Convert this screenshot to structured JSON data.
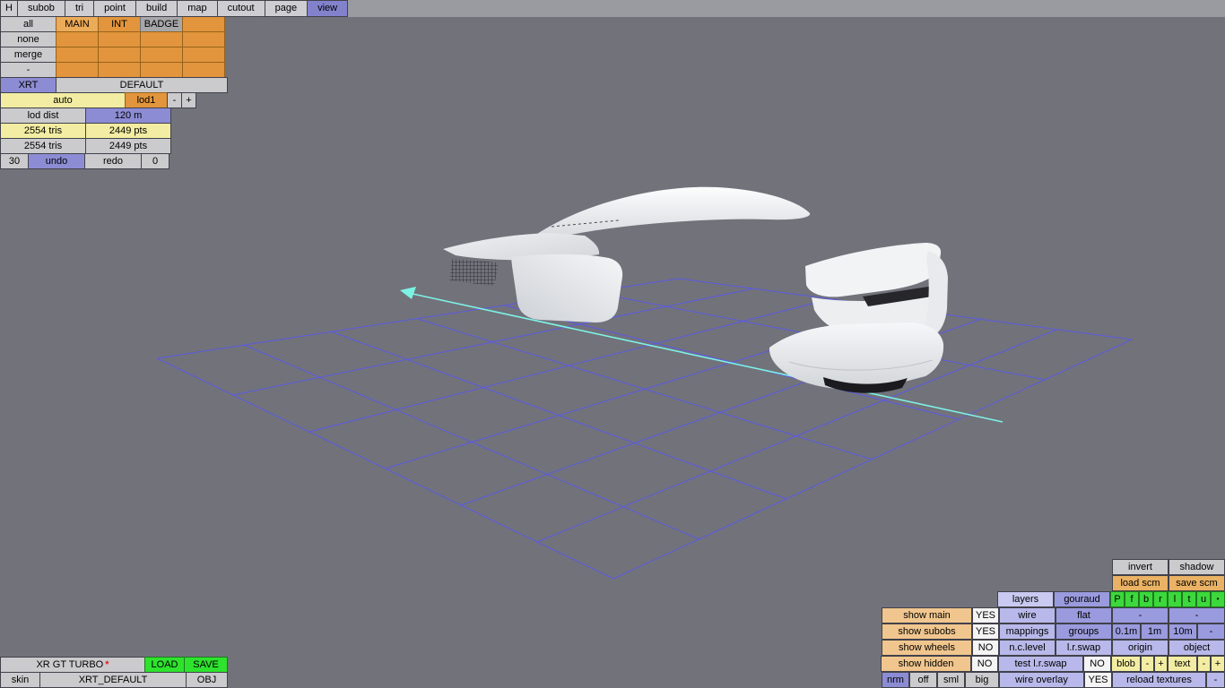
{
  "colors": {
    "viewport_bg": "#72727b",
    "grid": "#5a5ae8",
    "axis": "#7df2e4",
    "accent_blue": "#8c8cd4",
    "accent_orange": "#e2953c",
    "accent_yellow": "#f2eda2",
    "accent_tan": "#f0c68e",
    "accent_lavender": "#b8b8ea",
    "accent_purple": "#9a9ade",
    "accent_green": "#2ee22e",
    "dirty_marker_color": "#e02020"
  },
  "menubar": {
    "items": [
      "H",
      "subob",
      "tri",
      "point",
      "build",
      "map",
      "cutout",
      "page",
      "view"
    ],
    "active_item": "view"
  },
  "left_panel": {
    "select": {
      "all": "all",
      "none": "none",
      "merge": "merge",
      "dash": "-"
    },
    "materials": {
      "col1": "MAIN",
      "col2": "INT",
      "col3": "BADGE",
      "col4": ""
    },
    "bank": {
      "label": "XRT",
      "value": "DEFAULT"
    },
    "lod": {
      "auto": "auto",
      "current": "lod1",
      "minus": "-",
      "plus": "+",
      "dist_label": "lod dist",
      "dist_value": "120 m"
    },
    "stats": {
      "tris_sel": "2554 tris",
      "pts_sel": "2449 pts",
      "tris_total": "2554 tris",
      "pts_total": "2449 pts"
    },
    "history": {
      "undo_count": "30",
      "undo": "undo",
      "redo": "redo",
      "redo_count": "0"
    }
  },
  "bottom_left": {
    "car_name": "XR GT TURBO",
    "dirty_marker": "*",
    "load": "LOAD",
    "save": "SAVE",
    "skin_label": "skin",
    "skin_value": "XRT_DEFAULT",
    "obj": "OBJ"
  },
  "bottom_right": {
    "invert": "invert",
    "shadow": "shadow",
    "load_scm": "load scm",
    "save_scm": "save scm",
    "layers": "layers",
    "gouraud": "gouraud",
    "views": [
      "P",
      "f",
      "b",
      "r",
      "l",
      "t",
      "u"
    ],
    "view_dot": "•",
    "show_main": "show main",
    "show_main_value": "YES",
    "wire": "wire",
    "flat": "flat",
    "wire_dash": "-",
    "flat_dash": "-",
    "show_subobs": "show subobs",
    "show_subobs_value": "YES",
    "mappings": "mappings",
    "groups": "groups",
    "grid_steps": [
      "0.1m",
      "1m",
      "10m",
      "-"
    ],
    "show_wheels": "show wheels",
    "show_wheels_value": "NO",
    "nc_level": "n.c.level",
    "lr_swap": "l.r.swap",
    "origin": "origin",
    "object": "object",
    "show_hidden": "show hidden",
    "show_hidden_value": "NO",
    "test_lr_swap": "test l.r.swap",
    "test_lr_swap_value": "NO",
    "blob": "blob",
    "blob_minus": "-",
    "blob_plus": "+",
    "text": "text",
    "text_minus": "-",
    "text_plus": "+",
    "nrm": "nrm",
    "off": "off",
    "sml": "sml",
    "big": "big",
    "wire_overlay": "wire overlay",
    "wire_overlay_value": "YES",
    "reload_textures": "reload textures",
    "reload_dash": "-"
  }
}
